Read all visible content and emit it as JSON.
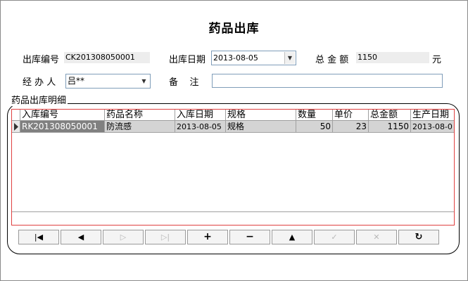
{
  "title": "药品出库",
  "form": {
    "out_no_label": "出库编号",
    "out_no_value": "CK201308050001",
    "out_date_label": "出库日期",
    "out_date_value": "2013-08-05",
    "total_label": "总 金 额",
    "total_value": "1150",
    "total_unit": "元",
    "handler_label": "经 办 人",
    "handler_value": "吕**",
    "remark_label": "备    注",
    "remark_value": ""
  },
  "detail": {
    "group_label": "药品出库明细",
    "columns": [
      "入库编号",
      "药品名称",
      "入库日期",
      "规格",
      "数量",
      "单价",
      "总金额",
      "生产日期"
    ],
    "rows": [
      [
        "RK201308050001",
        "防流感",
        "2013-08-05",
        "规格",
        "50",
        "23",
        "1150",
        "2013-08-0"
      ]
    ]
  },
  "navigator": {
    "buttons": [
      {
        "name": "first-record-icon",
        "glyph": "|◀",
        "enabled": true
      },
      {
        "name": "prior-record-icon",
        "glyph": "◀",
        "enabled": true
      },
      {
        "name": "next-record-icon",
        "glyph": "▷",
        "enabled": false
      },
      {
        "name": "last-record-icon",
        "glyph": "▷|",
        "enabled": false
      },
      {
        "name": "insert-icon",
        "glyph": "+",
        "enabled": true
      },
      {
        "name": "delete-icon",
        "glyph": "−",
        "enabled": true
      },
      {
        "name": "edit-icon",
        "glyph": "▲",
        "enabled": true
      },
      {
        "name": "post-icon",
        "glyph": "✓",
        "enabled": false
      },
      {
        "name": "cancel-icon",
        "glyph": "✕",
        "enabled": false
      },
      {
        "name": "refresh-icon",
        "glyph": "↻",
        "enabled": true
      }
    ]
  }
}
